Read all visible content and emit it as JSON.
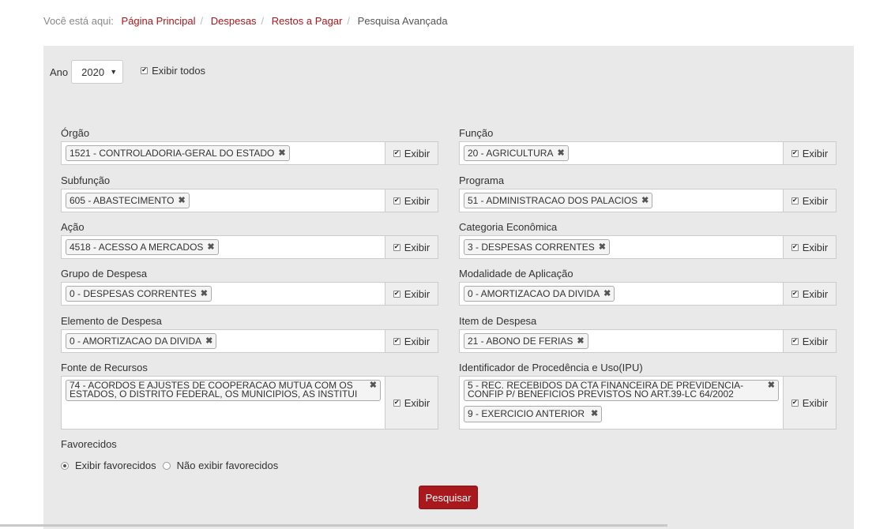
{
  "breadcrumb": {
    "prefix": "Você está aqui:",
    "items": [
      "Página Principal",
      "Despesas",
      "Restos a Pagar"
    ],
    "current": "Pesquisa Avançada"
  },
  "year": {
    "label": "Ano",
    "value": "2020",
    "arrow": "▼"
  },
  "show_all": {
    "label": "Exibir todos",
    "checked": true
  },
  "checkbox_glyph": "✔",
  "remove_glyph": "✖",
  "exibir_label": "Exibir",
  "fields": [
    {
      "label": "Órgão",
      "chips": [
        "1521 - CONTROLADORIA-GERAL DO ESTADO"
      ]
    },
    {
      "label": "Função",
      "chips": [
        "20 - AGRICULTURA"
      ]
    },
    {
      "label": "Subfunção",
      "chips": [
        "605 - ABASTECIMENTO"
      ]
    },
    {
      "label": "Programa",
      "chips": [
        "51 - ADMINISTRACAO DOS PALACIOS"
      ]
    },
    {
      "label": "Ação",
      "chips": [
        "4518 - ACESSO A MERCADOS"
      ]
    },
    {
      "label": "Categoria Econômica",
      "chips": [
        "3 - DESPESAS CORRENTES"
      ]
    },
    {
      "label": "Grupo de Despesa",
      "chips": [
        "0 - DESPESAS CORRENTES"
      ]
    },
    {
      "label": "Modalidade de Aplicação",
      "chips": [
        "0 - AMORTIZACAO DA DIVIDA"
      ]
    },
    {
      "label": "Elemento de Despesa",
      "chips": [
        "0 - AMORTIZACAO DA DIVIDA"
      ]
    },
    {
      "label": "Item de Despesa",
      "chips": [
        "21 - ABONO DE FERIAS"
      ]
    },
    {
      "label": "Fonte de Recursos",
      "chips": [
        "74 - ACORDOS E AJUSTES DE COOPERACAO MUTUA COM OS ESTADOS, O DISTRITO FEDERAL, OS MUNICIPIOS, AS INSTITUI"
      ]
    },
    {
      "label": "Identificador de Procedência e Uso(IPU)",
      "chips": [
        "5 - REC. RECEBIDOS DA CTA FINANCEIRA DE PREVIDENCIA-CONFIP P/ BENEFICIOS PREVISTOS NO ART.39-LC 64/2002",
        "9 - EXERCICIO ANTERIOR"
      ]
    }
  ],
  "favorecidos": {
    "label": "Favorecidos",
    "options": [
      {
        "label": "Exibir favorecidos",
        "selected": true
      },
      {
        "label": "Não exibir favorecidos",
        "selected": false
      }
    ]
  },
  "search_button": "Pesquisar"
}
